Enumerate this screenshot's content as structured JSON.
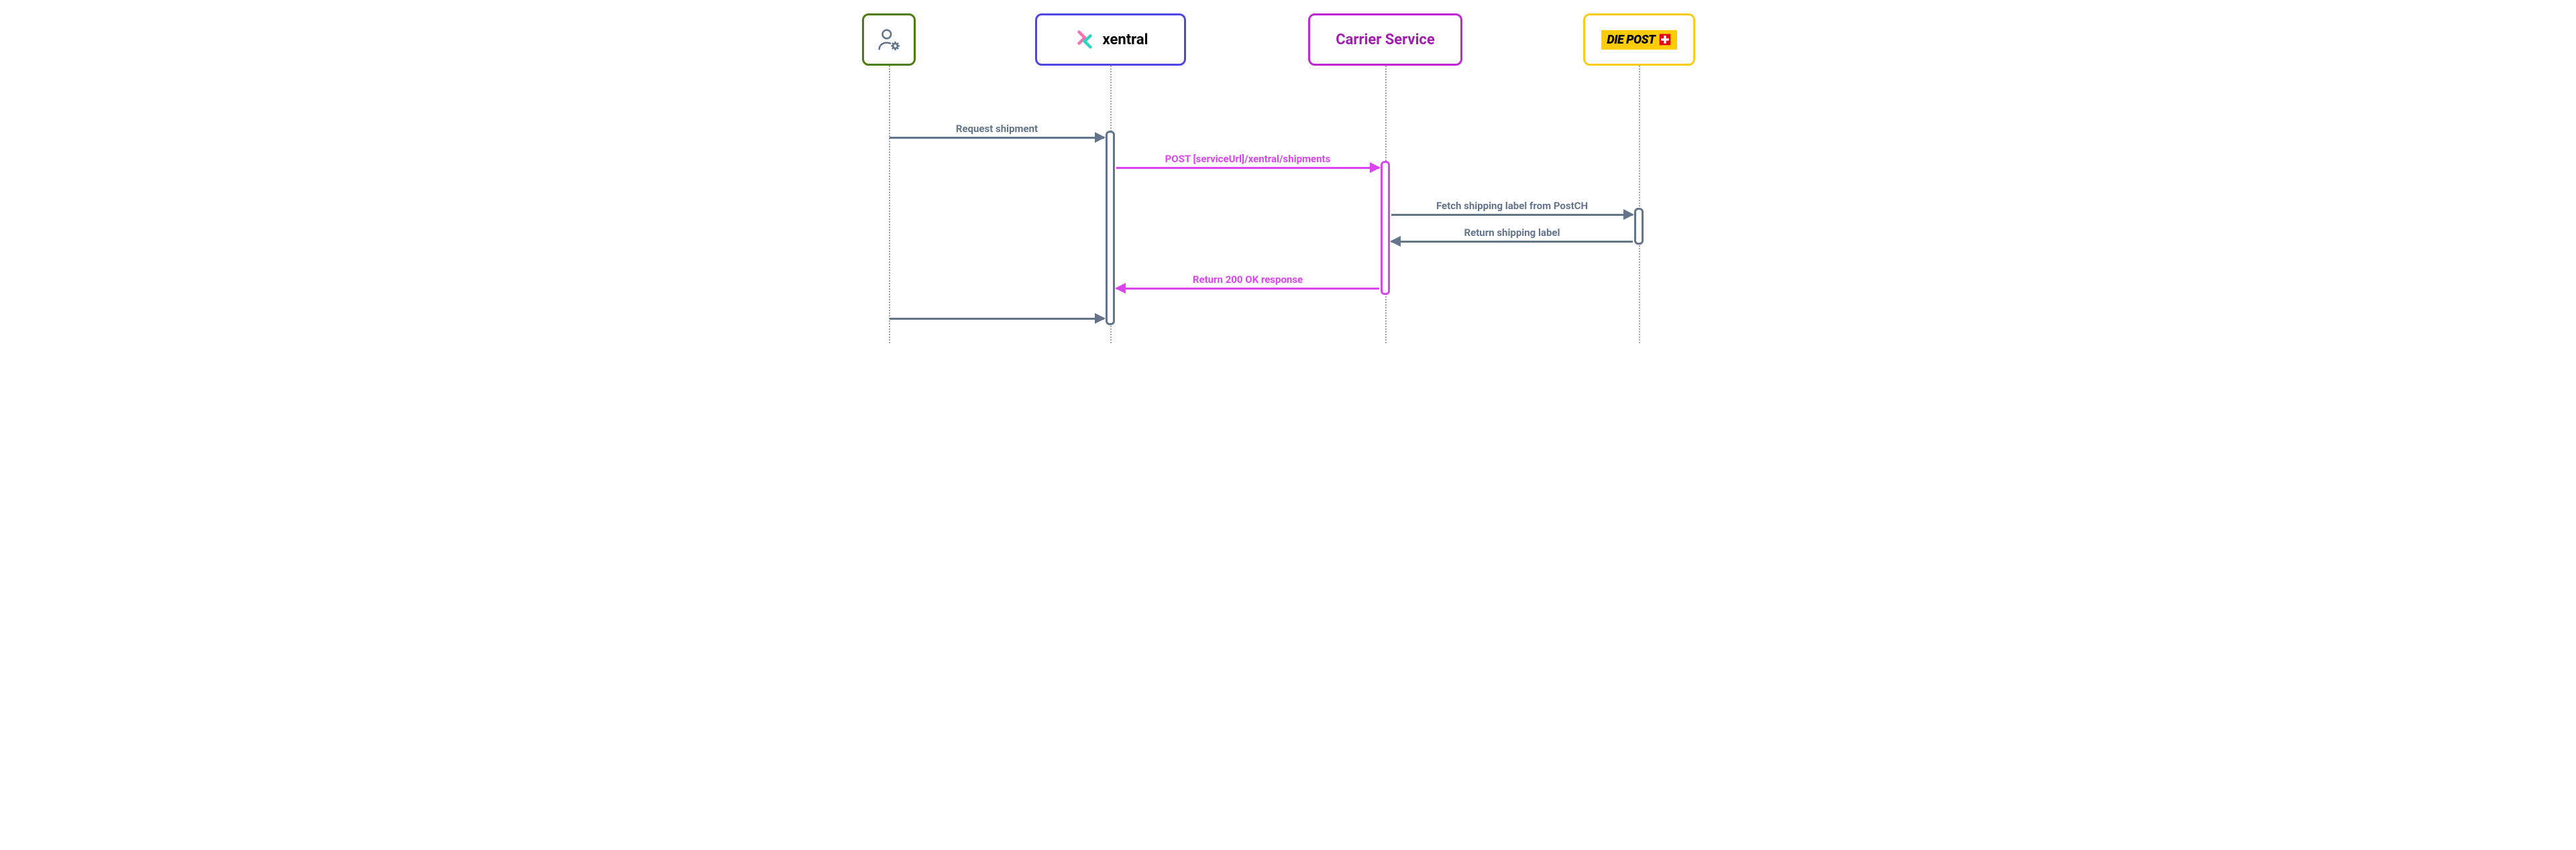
{
  "participants": {
    "user": {
      "color": "#4d7c0f"
    },
    "xentral": {
      "color": "#4f46e5",
      "label": "xentral"
    },
    "carrier": {
      "color": "#c026d3",
      "label": "Carrier Service"
    },
    "diepost": {
      "color": "#facc15",
      "label": "DIE POST"
    }
  },
  "messages": {
    "request_shipment": {
      "label": "Request shipment",
      "color": "#64748b"
    },
    "post_shipments": {
      "label": "POST [serviceUrl]/xentral/shipments",
      "color": "#d946ef"
    },
    "fetch_label": {
      "label": "Fetch shipping label from PostCH",
      "color": "#64748b"
    },
    "return_label": {
      "label": "Return shipping label",
      "color": "#64748b"
    },
    "return_200": {
      "label": "Return 200 OK response",
      "color": "#d946ef"
    },
    "final": {
      "label": "",
      "color": "#64748b"
    }
  },
  "palette": {
    "lifeline_gray": "#64748b"
  }
}
